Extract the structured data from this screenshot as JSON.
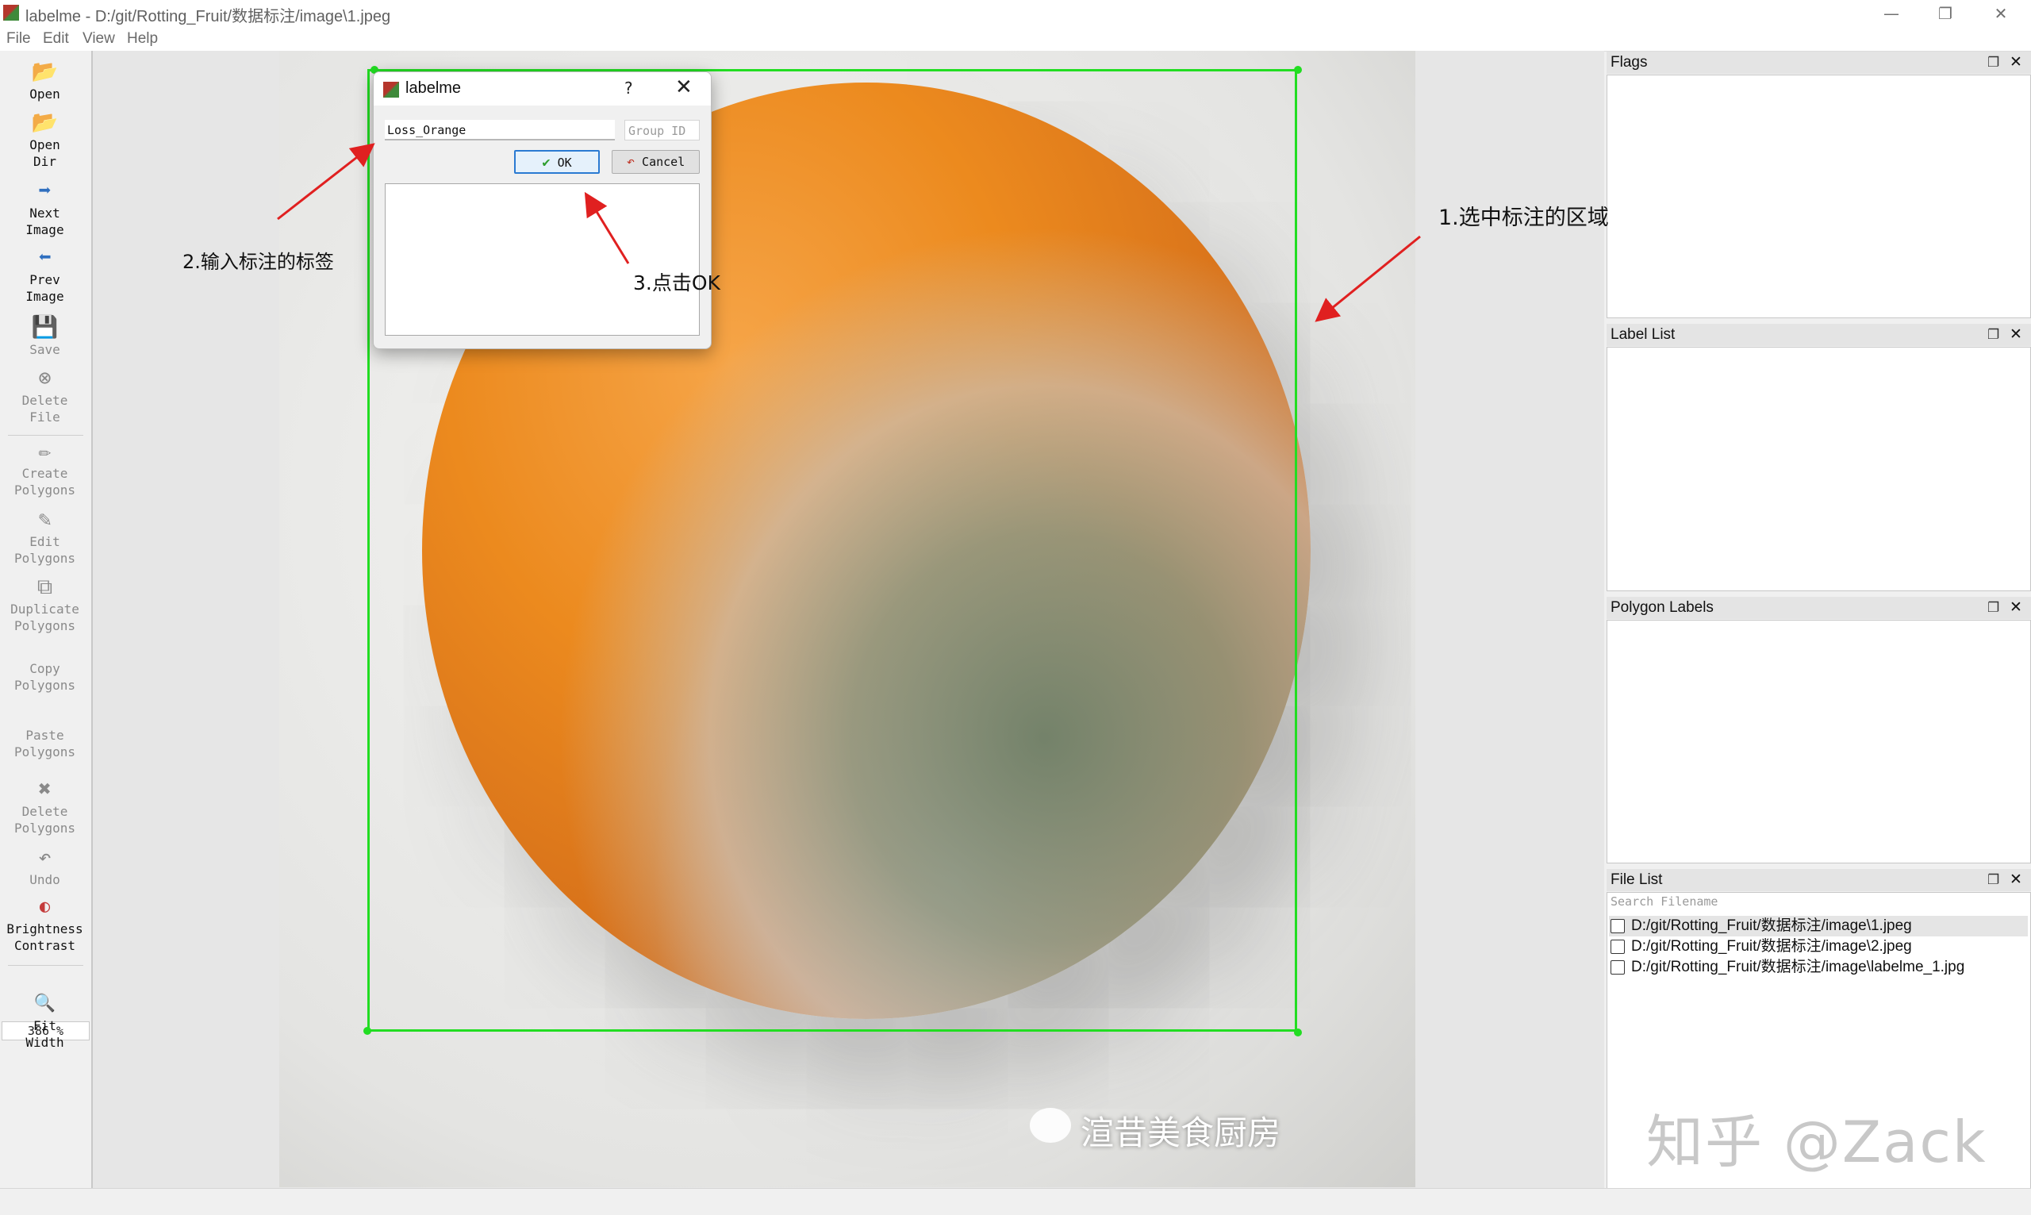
{
  "window": {
    "title": "labelme - D:/git/Rotting_Fruit/数据标注/image\\1.jpeg",
    "controls": [
      "—",
      "❐",
      "✕"
    ]
  },
  "menu": [
    "File",
    "Edit",
    "View",
    "Help"
  ],
  "toolbar": {
    "open": "Open",
    "open_dir": "Open\nDir",
    "next_image": "Next\nImage",
    "prev_image": "Prev\nImage",
    "save": "Save",
    "delete_file": "Delete\nFile",
    "create_polygons": "Create\nPolygons",
    "edit_polygons": "Edit\nPolygons",
    "duplicate_polygons": "Duplicate\nPolygons",
    "copy_polygons": "Copy\nPolygons",
    "paste_polygons": "Paste\nPolygons",
    "delete_polygons": "Delete\nPolygons",
    "undo": "Undo",
    "brightness_contrast": "Brightness\nContrast",
    "zoom": "386 %",
    "fit_width": "Fit\nWidth"
  },
  "dialog": {
    "title": "labelme",
    "help": "?",
    "label_value": "Loss_Orange",
    "group_id_placeholder": "Group ID",
    "ok_label": "OK",
    "cancel_label": "Cancel"
  },
  "docks": {
    "flags": "Flags",
    "label_list": "Label List",
    "polygon_labels": "Polygon Labels",
    "file_list": "File List",
    "search_placeholder": "Search Filename",
    "files": [
      "D:/git/Rotting_Fruit/数据标注/image\\1.jpeg",
      "D:/git/Rotting_Fruit/数据标注/image\\2.jpeg",
      "D:/git/Rotting_Fruit/数据标注/image\\labelme_1.jpg"
    ]
  },
  "annotations": {
    "step1": "1.选中标注的区域",
    "step2": "2.输入标注的标签",
    "step3": "3.点击OK"
  },
  "image_watermark": "渲昔美食厨房",
  "page_watermark": "知乎 @Zack",
  "colors": {
    "selection": "#22dd22",
    "arrow": "#e02020",
    "ok_border": "#2a7ad2"
  }
}
